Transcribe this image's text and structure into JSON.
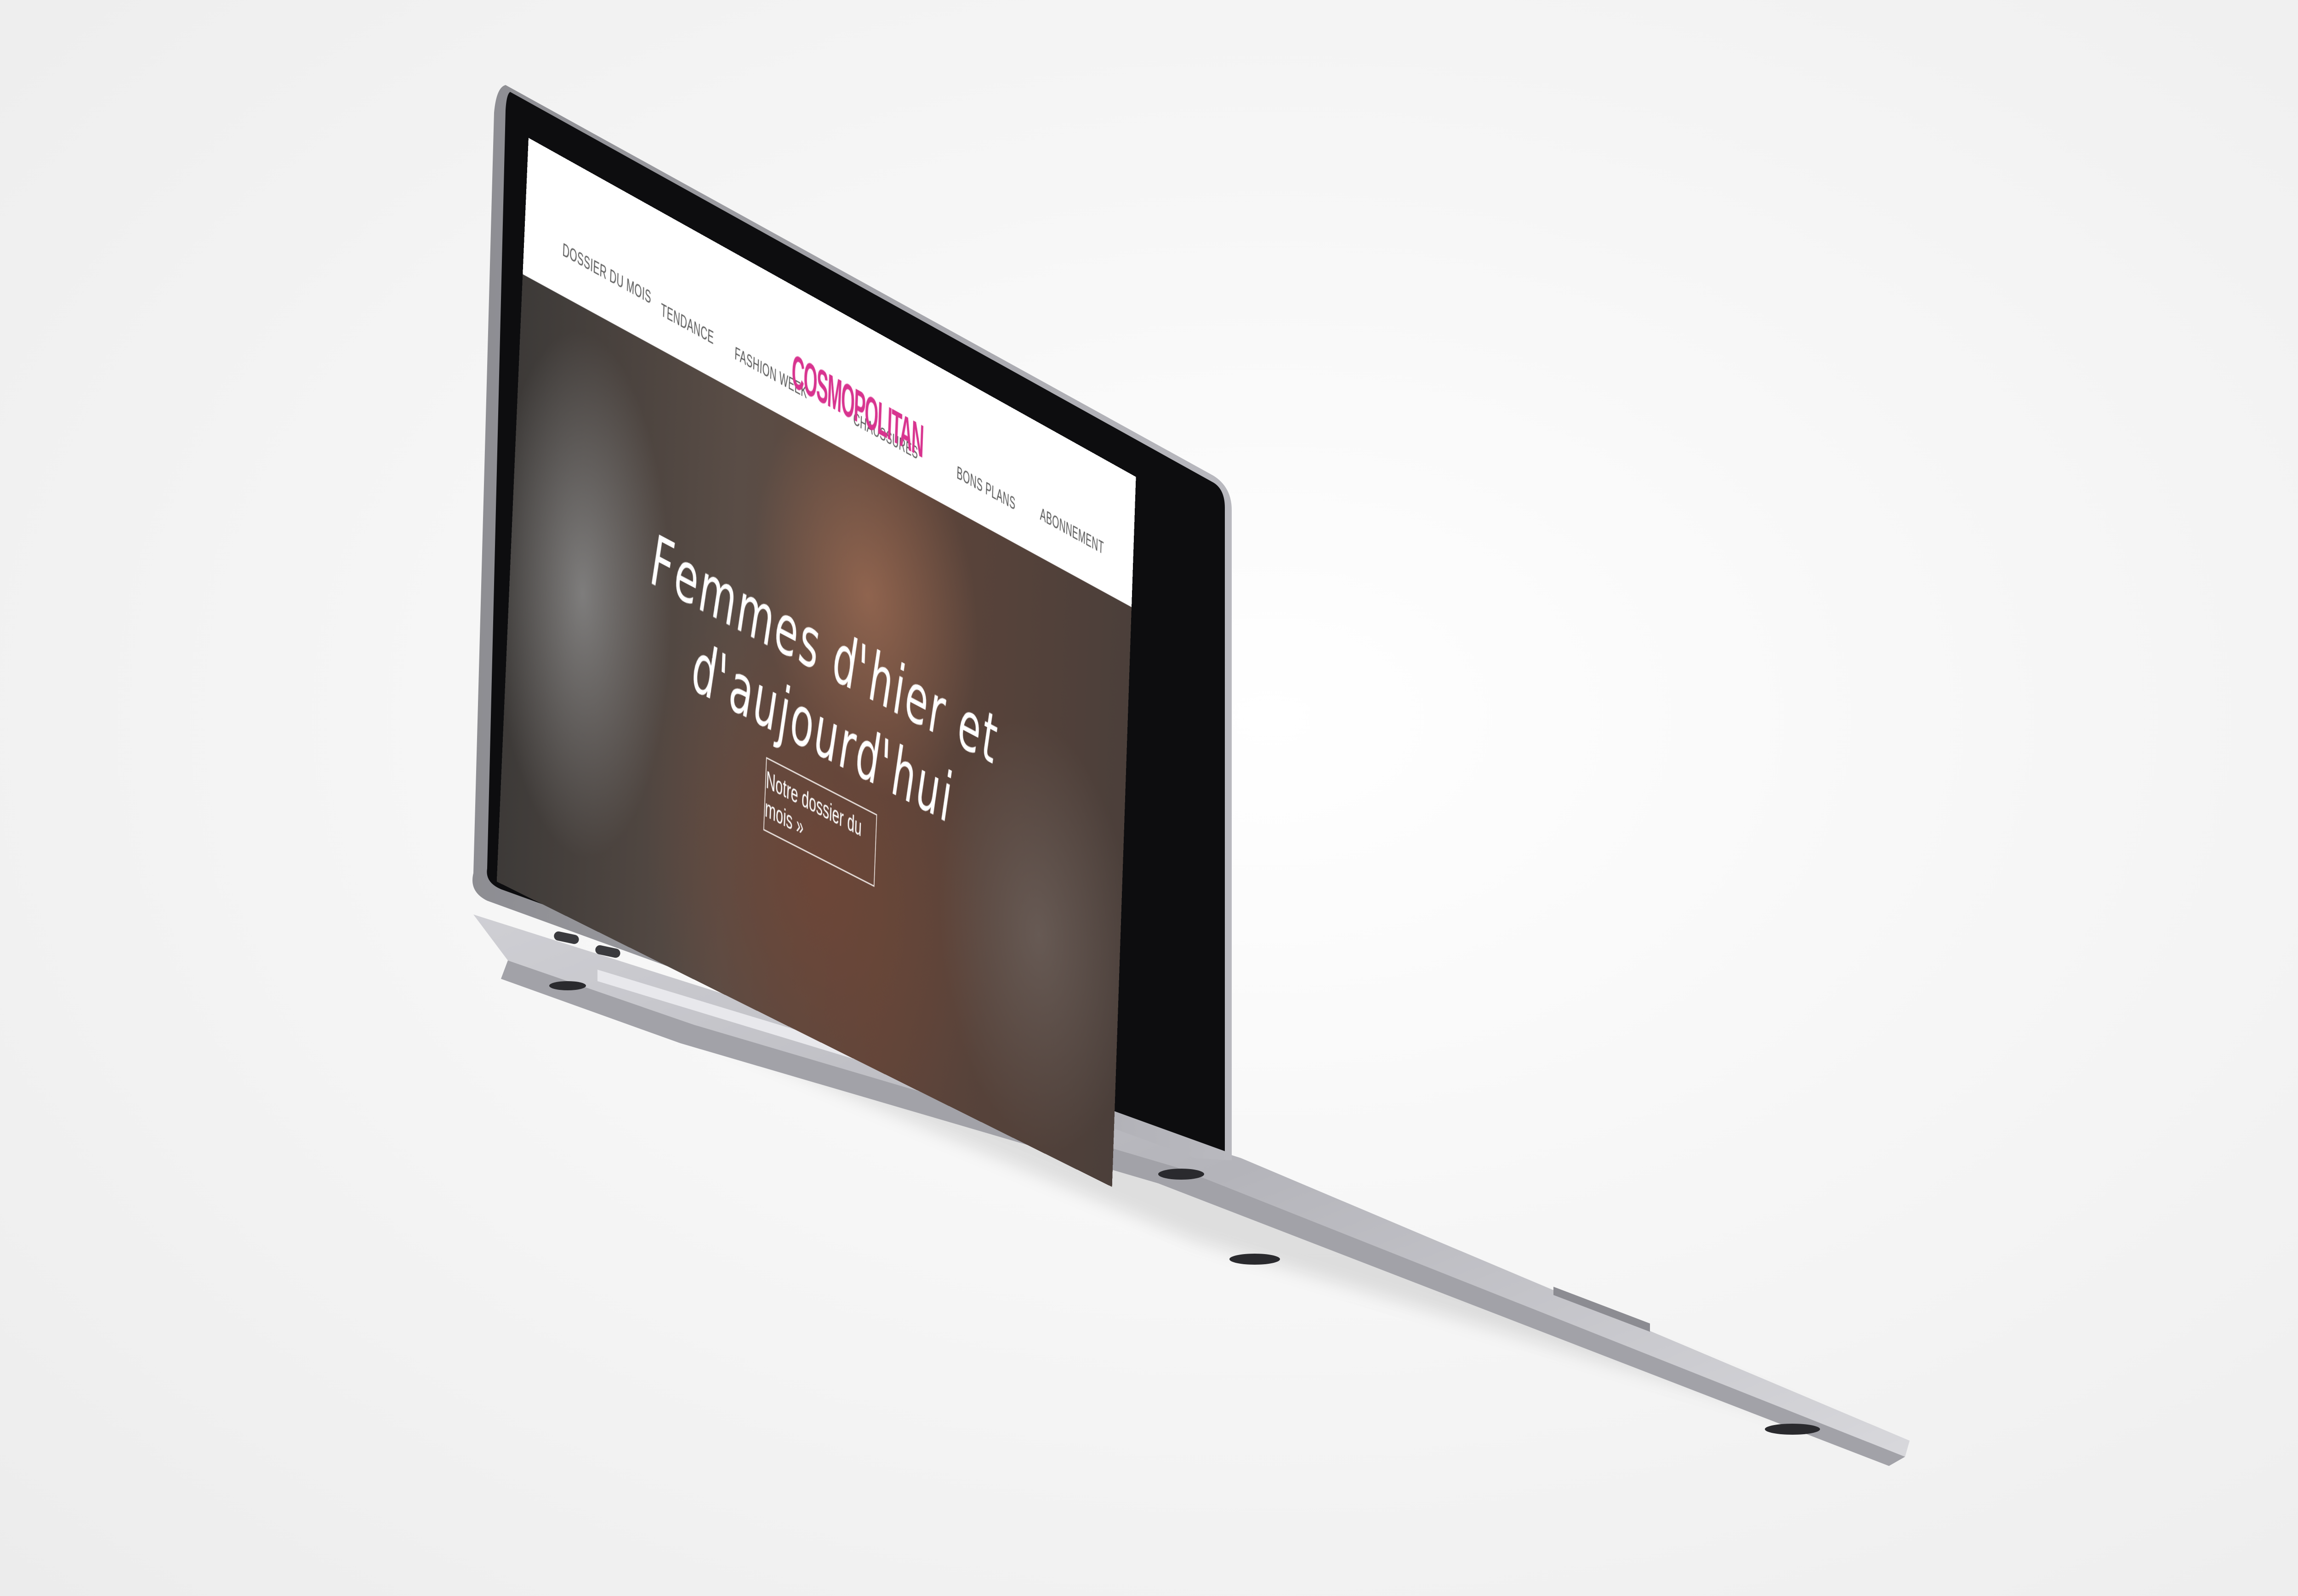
{
  "site": {
    "logo": "COSMOPOLITAN",
    "brand_color": "#d8348f"
  },
  "nav": {
    "items": [
      {
        "label": "DOSSIER DU MOIS"
      },
      {
        "label": "TENDANCE"
      },
      {
        "label": "FASHION WEEK"
      },
      {
        "label": "CHAUSSURES"
      },
      {
        "label": "BONS PLANS"
      },
      {
        "label": "ABONNEMENT"
      }
    ]
  },
  "hero": {
    "title": "Femmes d'hier et d'aujourd'hui",
    "cta_label": "Notre dossier du mois »"
  }
}
